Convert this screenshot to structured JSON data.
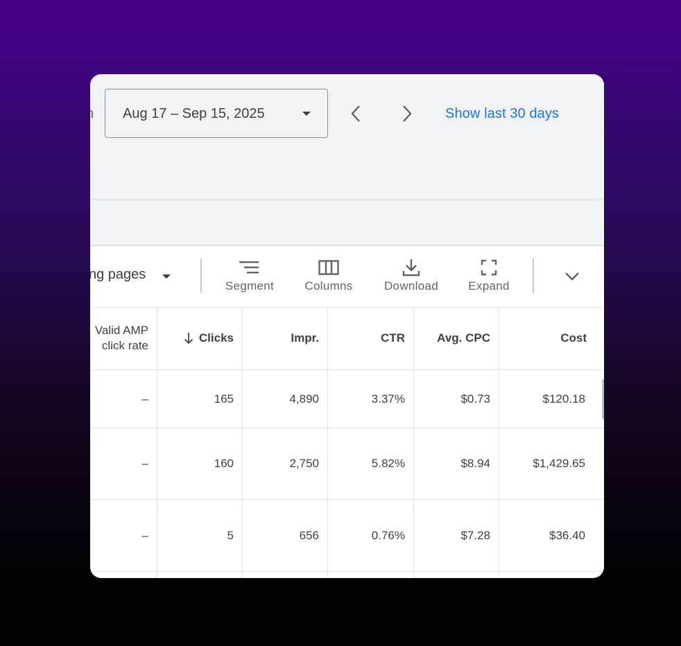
{
  "date_range": {
    "clipped_prefix": "n",
    "label": "Aug 17 – Sep 15, 2025"
  },
  "nav": {
    "prev_icon": "chevron-left-icon",
    "next_icon": "chevron-right-icon"
  },
  "show_last_link": "Show last 30 days",
  "accent_color": "#1a73e8",
  "toolbar": {
    "view_label": "ng pages",
    "segment_label": "Segment",
    "columns_label": "Columns",
    "download_label": "Download",
    "expand_label": "Expand"
  },
  "table": {
    "headers": {
      "amp_line1": "Valid AMP",
      "amp_line2": "click rate",
      "clicks": "Clicks",
      "impr": "Impr.",
      "ctr": "CTR",
      "avg_cpc": "Avg. CPC",
      "cost": "Cost"
    },
    "rows": [
      {
        "amp": "–",
        "clicks": "165",
        "impr": "4,890",
        "ctr": "3.37%",
        "cpc": "$0.73",
        "cost": "$120.18"
      },
      {
        "amp": "–",
        "clicks": "160",
        "impr": "2,750",
        "ctr": "5.82%",
        "cpc": "$8.94",
        "cost": "$1,429.65"
      },
      {
        "amp": "–",
        "clicks": "5",
        "impr": "656",
        "ctr": "0.76%",
        "cpc": "$7.28",
        "cost": "$36.40"
      }
    ]
  }
}
